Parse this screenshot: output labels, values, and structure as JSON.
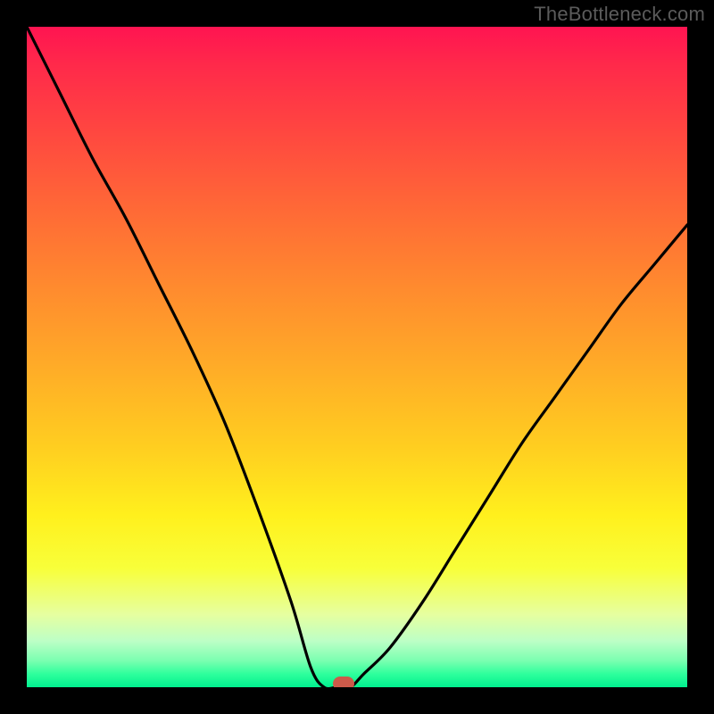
{
  "watermark": "TheBottleneck.com",
  "colors": {
    "frame_bg": "#000000",
    "watermark": "#5b5b5b",
    "curve": "#000000",
    "marker": "#cc5a4a",
    "gradient_top": "#ff1451",
    "gradient_bottom": "#00f08f"
  },
  "chart_data": {
    "type": "line",
    "title": "",
    "xlabel": "",
    "ylabel": "",
    "xlim": [
      0,
      100
    ],
    "ylim": [
      0,
      100
    ],
    "grid": false,
    "legend": false,
    "annotations": [
      "TheBottleneck.com"
    ],
    "series": [
      {
        "name": "bottleneck-curve",
        "x": [
          0,
          5,
          10,
          15,
          20,
          25,
          30,
          35,
          40,
          43,
          45,
          47,
          49,
          51,
          55,
          60,
          65,
          70,
          75,
          80,
          85,
          90,
          95,
          100
        ],
        "y": [
          100,
          90,
          80,
          71,
          61,
          51,
          40,
          27,
          13,
          3,
          0,
          0,
          0,
          2,
          6,
          13,
          21,
          29,
          37,
          44,
          51,
          58,
          64,
          70
        ]
      }
    ],
    "marker": {
      "x": 48,
      "y": 0
    }
  }
}
